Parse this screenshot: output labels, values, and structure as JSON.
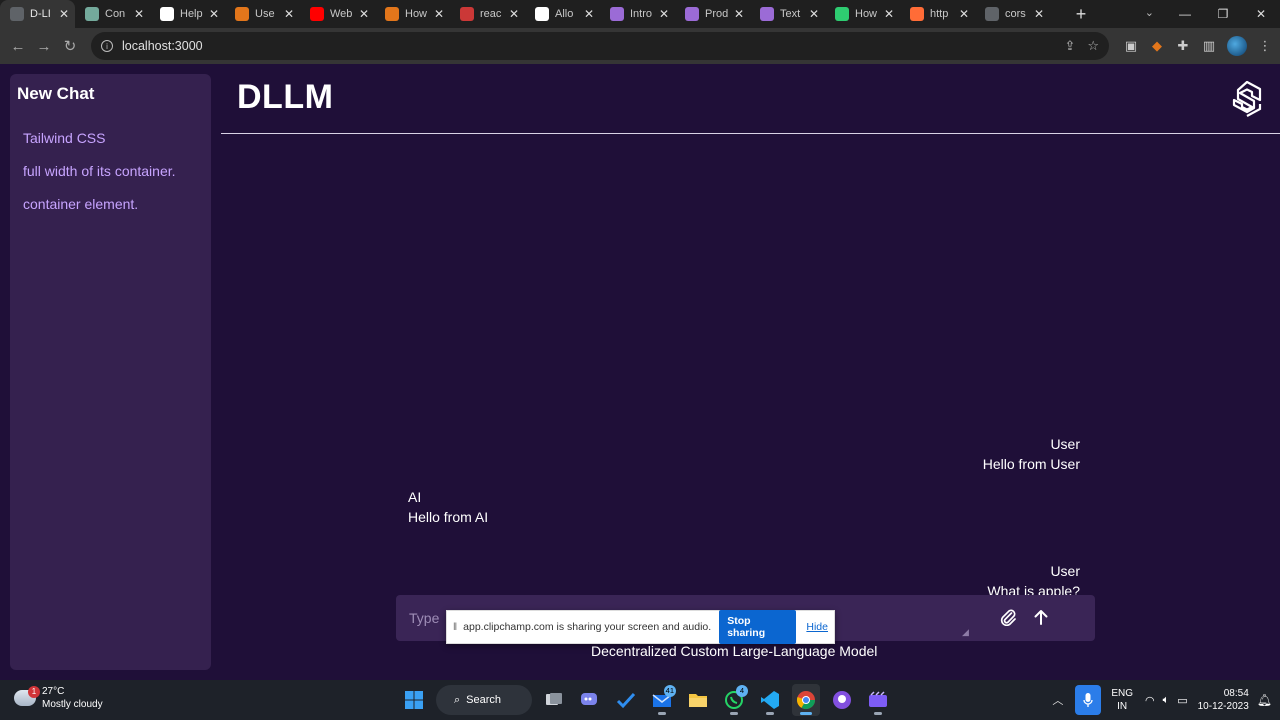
{
  "browser": {
    "tabs": [
      {
        "label": "D-LI",
        "icon": "globe-icon",
        "color": "#5f6368"
      },
      {
        "label": "Con",
        "icon": "chatgpt-icon",
        "color": "#74aa9c"
      },
      {
        "label": "Help",
        "icon": "openai-icon",
        "color": "#ffffff"
      },
      {
        "label": "Use",
        "icon": "metamask-icon",
        "color": "#e2761b"
      },
      {
        "label": "Web",
        "icon": "youtube-icon",
        "color": "#ff0000"
      },
      {
        "label": "How",
        "icon": "metamask-icon",
        "color": "#e2761b"
      },
      {
        "label": "reac",
        "icon": "npm-icon",
        "color": "#cb3837"
      },
      {
        "label": "Allo",
        "icon": "github-icon",
        "color": "#ffffff"
      },
      {
        "label": "Intro",
        "icon": "dots-icon",
        "color": "#9b6bd6"
      },
      {
        "label": "Prod",
        "icon": "dots-icon",
        "color": "#9b6bd6"
      },
      {
        "label": "Text",
        "icon": "dots-icon",
        "color": "#9b6bd6"
      },
      {
        "label": "How",
        "icon": "infinity-icon",
        "color": "#2ecc71"
      },
      {
        "label": "http",
        "icon": "postman-icon",
        "color": "#ff6c37"
      },
      {
        "label": "cors",
        "icon": "globe-icon",
        "color": "#5f6368"
      }
    ],
    "url": "localhost:3000"
  },
  "sidebar": {
    "new_chat": "New Chat",
    "history": [
      "Tailwind CSS",
      "full width of its container.",
      "container element."
    ]
  },
  "header": {
    "brand": "DLLM"
  },
  "messages": [
    {
      "role": "user",
      "sender": "User",
      "text": "Hello from User"
    },
    {
      "role": "ai",
      "sender": "AI",
      "text": "Hello from AI"
    },
    {
      "role": "user",
      "sender": "User",
      "text": "What is apple?"
    }
  ],
  "composer": {
    "placeholder": "Type"
  },
  "share_bar": {
    "text": "app.clipchamp.com is sharing your screen and audio.",
    "stop_label": "Stop sharing",
    "hide_label": "Hide"
  },
  "footer": {
    "tagline": "Decentralized Custom Large-Language Model"
  },
  "taskbar": {
    "weather_temp": "27°C",
    "weather_desc": "Mostly cloudy",
    "weather_badge": "1",
    "search_label": "Search",
    "mail_badge": "41",
    "whatsapp_badge": "4",
    "lang_line1": "ENG",
    "lang_line2": "IN",
    "time": "08:54",
    "date": "10-12-2023"
  },
  "colors": {
    "background": "#1f0f38",
    "sidebar": "#35214f",
    "history_text": "#c7a4ff",
    "input_bg": "#3a2556"
  }
}
